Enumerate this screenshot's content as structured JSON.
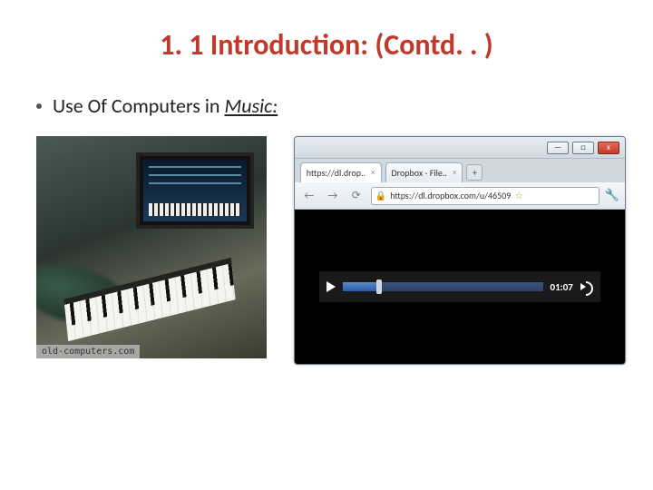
{
  "slide": {
    "title": "1. 1 Introduction: (Contd. . )",
    "bullet_prefix": "Use Of Computers in ",
    "bullet_emph": "Music:"
  },
  "left_image": {
    "watermark": "old-computers.com"
  },
  "browser": {
    "window_buttons": {
      "minimize": "—",
      "maximize": "□",
      "close": "x"
    },
    "tabs": [
      {
        "label": "https://dl.drop..",
        "active": true
      },
      {
        "label": "Dropbox - File..",
        "active": false
      }
    ],
    "new_tab": "+",
    "nav": {
      "back": "←",
      "forward": "→",
      "reload": "⟳"
    },
    "address": {
      "lock": "🔒",
      "url": "https://dl.dropbox.com/u/46509",
      "star": "☆"
    },
    "wrench": "🔧",
    "player": {
      "time": "01:07"
    }
  }
}
